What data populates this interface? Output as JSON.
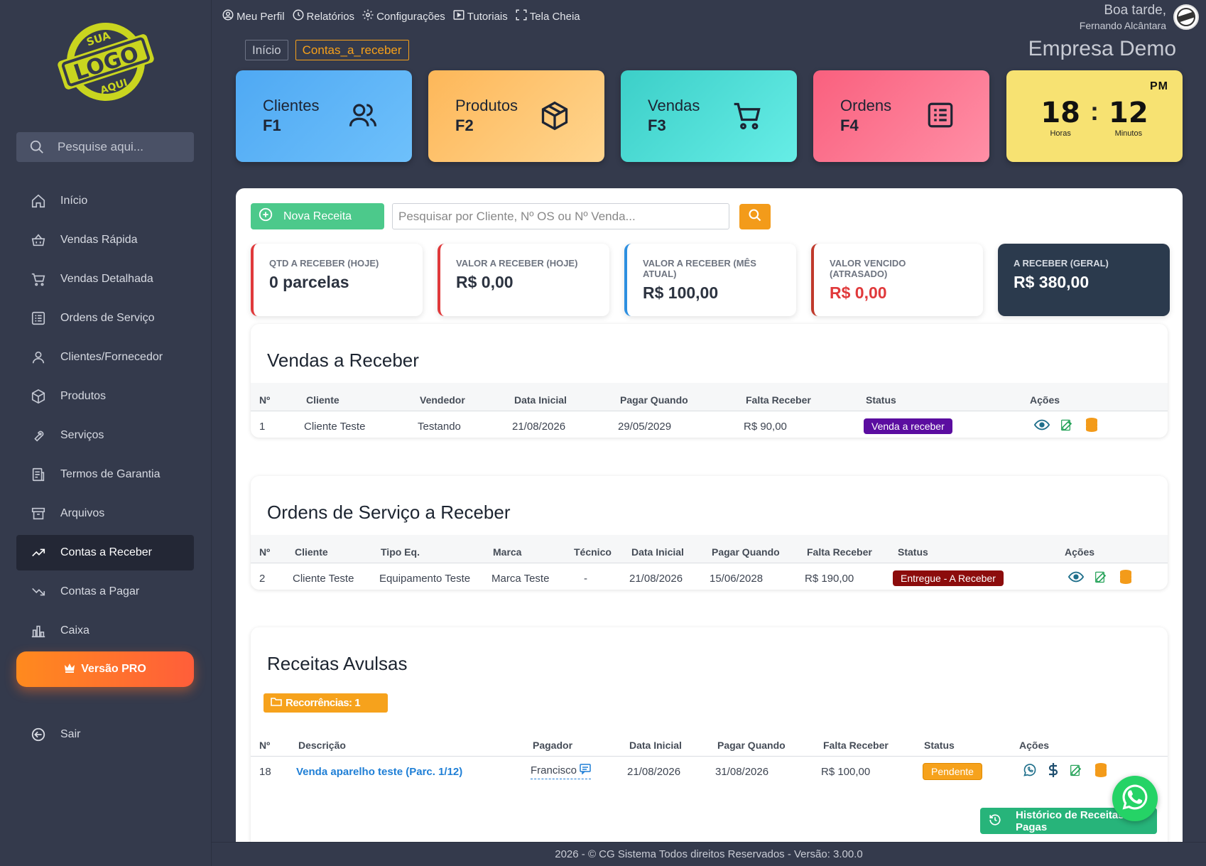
{
  "colors": {
    "sidebar_bg": "#343a4c",
    "accent_orange": "#f39b1a",
    "accent_green": "#4cc98b",
    "danger": "#e0393b"
  },
  "logo": {
    "alt_text": "SUA LOGO AQUI"
  },
  "search": {
    "placeholder": "Pesquise aqui..."
  },
  "nav": [
    {
      "label": "Início",
      "icon": "home-icon"
    },
    {
      "label": "Vendas Rápida",
      "icon": "basket-icon"
    },
    {
      "label": "Vendas Detalhada",
      "icon": "cart-icon"
    },
    {
      "label": "Ordens de Serviço",
      "icon": "list-icon"
    },
    {
      "label": "Clientes/Fornecedor",
      "icon": "user-icon"
    },
    {
      "label": "Produtos",
      "icon": "box-icon"
    },
    {
      "label": "Serviços",
      "icon": "wrench-icon"
    },
    {
      "label": "Termos de Garantia",
      "icon": "document-icon"
    },
    {
      "label": "Arquivos",
      "icon": "archive-icon"
    },
    {
      "label": "Contas a Receber",
      "icon": "trend-up-icon",
      "active": true
    },
    {
      "label": "Contas a Pagar",
      "icon": "trend-down-icon"
    },
    {
      "label": "Caixa",
      "icon": "bar-chart-icon"
    }
  ],
  "pro_button": "Versão PRO",
  "logout": "Sair",
  "topmenu": [
    {
      "label": "Meu Perfil",
      "icon": "user-circle-icon"
    },
    {
      "label": "Relatórios",
      "icon": "clock-icon"
    },
    {
      "label": "Configurações",
      "icon": "gear-icon"
    },
    {
      "label": "Tutoriais",
      "icon": "play-icon"
    },
    {
      "label": "Tela Cheia",
      "icon": "fullscreen-icon"
    }
  ],
  "greeting": {
    "line1": "Boa tarde,",
    "user": "Fernando Alcântara"
  },
  "company": "Empresa Demo",
  "breadcrumb": {
    "home": "Início",
    "current": "Contas_a_receber"
  },
  "tiles": [
    {
      "title": "Clientes",
      "key": "F1"
    },
    {
      "title": "Produtos",
      "key": "F2"
    },
    {
      "title": "Vendas",
      "key": "F3"
    },
    {
      "title": "Ordens",
      "key": "F4"
    }
  ],
  "clock": {
    "ampm": "PM",
    "hours": "18",
    "minutes": "12",
    "hours_label": "Horas",
    "minutes_label": "Minutos"
  },
  "toolbar": {
    "new_label": "Nova Receita",
    "search_placeholder": "Pesquisar por Cliente, Nº OS ou Nº Venda..."
  },
  "kpis": [
    {
      "label": "QTD A RECEBER (HOJE)",
      "value": "0 parcelas",
      "color": "#e0393b"
    },
    {
      "label": "VALOR A RECEBER (HOJE)",
      "value": "R$ 0,00",
      "color": "#e0393b"
    },
    {
      "label": "VALOR A RECEBER (MÊS ATUAL)",
      "value": "R$ 100,00",
      "color": "#2d8fe0"
    },
    {
      "label": "VALOR VENCIDO (ATRASADO)",
      "value": "R$ 0,00",
      "color": "#c0392b"
    },
    {
      "label": "A RECEBER (GERAL)",
      "value": "R$ 380,00"
    }
  ],
  "vendas": {
    "title": "Vendas a Receber",
    "headers": [
      "Nº",
      "Cliente",
      "Vendedor",
      "Data Inicial",
      "Pagar Quando",
      "Falta Receber",
      "Status",
      "Ações"
    ],
    "rows": [
      {
        "n": "1",
        "cliente": "Cliente Teste",
        "vendedor": "Testando",
        "data": "21/08/2026",
        "pagar": "29/05/2029",
        "falta": "R$ 90,00",
        "status": "Venda a receber"
      }
    ]
  },
  "ordens": {
    "title": "Ordens de Serviço a Receber",
    "headers": [
      "Nº",
      "Cliente",
      "Tipo Eq.",
      "Marca",
      "Técnico",
      "Data Inicial",
      "Pagar Quando",
      "Falta Receber",
      "Status",
      "Ações"
    ],
    "rows": [
      {
        "n": "2",
        "cliente": "Cliente Teste",
        "tipo": "Equipamento Teste",
        "marca": "Marca Teste",
        "tecnico": "-",
        "data": "21/08/2026",
        "pagar": "15/06/2028",
        "falta": "R$ 190,00",
        "status": "Entregue - A Receber"
      }
    ]
  },
  "avulsas": {
    "title": "Receitas Avulsas",
    "recorrencias": "Recorrências: 1",
    "headers": [
      "Nº",
      "Descrição",
      "Pagador",
      "Data Inicial",
      "Pagar Quando",
      "Falta Receber",
      "Status",
      "Ações"
    ],
    "rows": [
      {
        "n": "18",
        "descricao": "Venda aparelho teste (Parc. 1/12)",
        "pagador": "Francisco",
        "data": "21/08/2026",
        "pagar": "31/08/2026",
        "falta": "R$ 100,00",
        "status": "Pendente"
      }
    ]
  },
  "history_button": "Histórico de Receitas Pagas",
  "footer": "2026 - © CG Sistema Todos direitos Reservados - Versão: 3.00.0"
}
